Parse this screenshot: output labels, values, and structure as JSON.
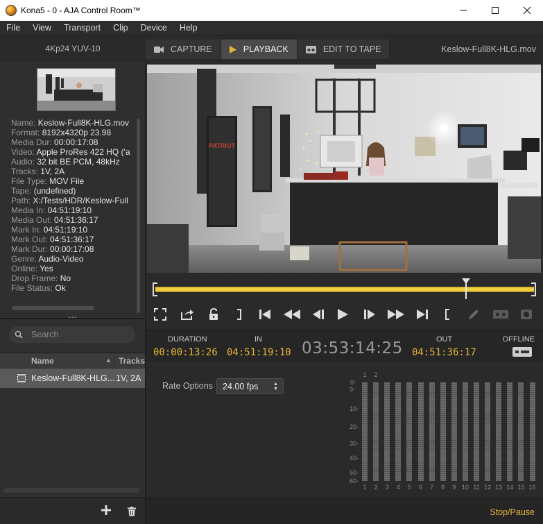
{
  "window": {
    "title": "Kona5 - 0 - AJA Control Room™",
    "minimize": "—",
    "maximize": "☐",
    "close": "✕"
  },
  "menu": [
    "File",
    "View",
    "Transport",
    "Clip",
    "Device",
    "Help"
  ],
  "left": {
    "format": "4Kp24  YUV-10",
    "info": [
      {
        "k": "Name:",
        "v": "Keslow-Full8K-HLG.mov"
      },
      {
        "k": "Format:",
        "v": "8192x4320p 23.98"
      },
      {
        "k": "Media Dur:",
        "v": "00:00:17:08"
      },
      {
        "k": "Video:",
        "v": "Apple ProRes 422 HQ ('a"
      },
      {
        "k": "Audio:",
        "v": "32 bit BE PCM, 48kHz"
      },
      {
        "k": "Tracks:",
        "v": "1V, 2A"
      },
      {
        "k": "File Type:",
        "v": "MOV File"
      },
      {
        "k": "Tape:",
        "v": "(undefined)"
      },
      {
        "k": "Path:",
        "v": "X:/Tests/HDR/Keslow-Full"
      },
      {
        "k": "Media In:",
        "v": "04:51:19:10"
      },
      {
        "k": "Media Out:",
        "v": "04:51:36:17"
      },
      {
        "k": "Mark In:",
        "v": "04:51:19:10"
      },
      {
        "k": "Mark Out:",
        "v": "04:51:36:17"
      },
      {
        "k": "Mark Dur:",
        "v": "00:00:17:08"
      },
      {
        "k": "Genre:",
        "v": "Audio-Video"
      },
      {
        "k": "Online:",
        "v": "Yes"
      },
      {
        "k": "Drop Frame:",
        "v": "No"
      },
      {
        "k": "File Status:",
        "v": "Ok"
      }
    ],
    "search_placeholder": "Search",
    "columns": {
      "name": "Name",
      "tracks": "Tracks"
    },
    "clip": {
      "name": "Keslow-Full8K-HLG...",
      "tracks": "1V, 2A"
    }
  },
  "tabs": [
    {
      "label": "CAPTURE",
      "icon": "camera-icon",
      "active": false
    },
    {
      "label": "PLAYBACK",
      "icon": "play-icon",
      "active": true
    },
    {
      "label": "EDIT TO TAPE",
      "icon": "tape-icon",
      "active": false
    }
  ],
  "filename": "Keslow-Full8K-HLG.mov",
  "scrubber": {
    "position": 0.82
  },
  "timecode": {
    "duration_label": "DURATION",
    "duration": "00:00:13:26",
    "in_label": "IN",
    "in": "04:51:19:10",
    "current": "03:53:14:25",
    "out_label": "OUT",
    "out": "04:51:36:17",
    "offline_label": "OFFLINE"
  },
  "rate": {
    "label": "Rate Options",
    "value": "24.00 fps"
  },
  "meters": {
    "scale": [
      "0-",
      "3-",
      "10-",
      "20-",
      "30-",
      "40-",
      "50-",
      "60-"
    ],
    "channels": [
      "1",
      "2",
      "3",
      "4",
      "5",
      "6",
      "7",
      "8",
      "9",
      "10",
      "11",
      "12",
      "13",
      "14",
      "15",
      "16"
    ],
    "top_labels": [
      "1",
      "2"
    ]
  },
  "status": "Stop/Pause",
  "colors": {
    "accent": "#e3b537",
    "scrub": "#efcf3d"
  }
}
